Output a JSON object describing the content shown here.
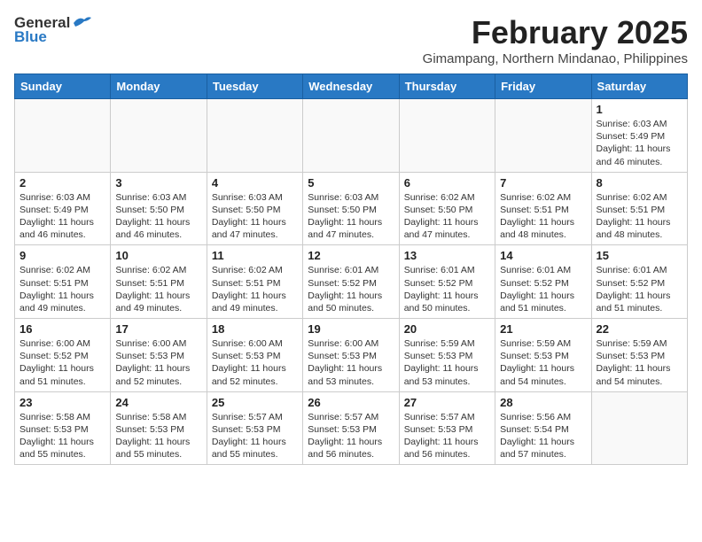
{
  "header": {
    "logo_general": "General",
    "logo_blue": "Blue",
    "title": "February 2025",
    "subtitle": "Gimampang, Northern Mindanao, Philippines"
  },
  "days_of_week": [
    "Sunday",
    "Monday",
    "Tuesday",
    "Wednesday",
    "Thursday",
    "Friday",
    "Saturday"
  ],
  "weeks": [
    [
      {
        "day": "",
        "info": ""
      },
      {
        "day": "",
        "info": ""
      },
      {
        "day": "",
        "info": ""
      },
      {
        "day": "",
        "info": ""
      },
      {
        "day": "",
        "info": ""
      },
      {
        "day": "",
        "info": ""
      },
      {
        "day": "1",
        "info": "Sunrise: 6:03 AM\nSunset: 5:49 PM\nDaylight: 11 hours and 46 minutes."
      }
    ],
    [
      {
        "day": "2",
        "info": "Sunrise: 6:03 AM\nSunset: 5:49 PM\nDaylight: 11 hours and 46 minutes."
      },
      {
        "day": "3",
        "info": "Sunrise: 6:03 AM\nSunset: 5:50 PM\nDaylight: 11 hours and 46 minutes."
      },
      {
        "day": "4",
        "info": "Sunrise: 6:03 AM\nSunset: 5:50 PM\nDaylight: 11 hours and 47 minutes."
      },
      {
        "day": "5",
        "info": "Sunrise: 6:03 AM\nSunset: 5:50 PM\nDaylight: 11 hours and 47 minutes."
      },
      {
        "day": "6",
        "info": "Sunrise: 6:02 AM\nSunset: 5:50 PM\nDaylight: 11 hours and 47 minutes."
      },
      {
        "day": "7",
        "info": "Sunrise: 6:02 AM\nSunset: 5:51 PM\nDaylight: 11 hours and 48 minutes."
      },
      {
        "day": "8",
        "info": "Sunrise: 6:02 AM\nSunset: 5:51 PM\nDaylight: 11 hours and 48 minutes."
      }
    ],
    [
      {
        "day": "9",
        "info": "Sunrise: 6:02 AM\nSunset: 5:51 PM\nDaylight: 11 hours and 49 minutes."
      },
      {
        "day": "10",
        "info": "Sunrise: 6:02 AM\nSunset: 5:51 PM\nDaylight: 11 hours and 49 minutes."
      },
      {
        "day": "11",
        "info": "Sunrise: 6:02 AM\nSunset: 5:51 PM\nDaylight: 11 hours and 49 minutes."
      },
      {
        "day": "12",
        "info": "Sunrise: 6:01 AM\nSunset: 5:52 PM\nDaylight: 11 hours and 50 minutes."
      },
      {
        "day": "13",
        "info": "Sunrise: 6:01 AM\nSunset: 5:52 PM\nDaylight: 11 hours and 50 minutes."
      },
      {
        "day": "14",
        "info": "Sunrise: 6:01 AM\nSunset: 5:52 PM\nDaylight: 11 hours and 51 minutes."
      },
      {
        "day": "15",
        "info": "Sunrise: 6:01 AM\nSunset: 5:52 PM\nDaylight: 11 hours and 51 minutes."
      }
    ],
    [
      {
        "day": "16",
        "info": "Sunrise: 6:00 AM\nSunset: 5:52 PM\nDaylight: 11 hours and 51 minutes."
      },
      {
        "day": "17",
        "info": "Sunrise: 6:00 AM\nSunset: 5:53 PM\nDaylight: 11 hours and 52 minutes."
      },
      {
        "day": "18",
        "info": "Sunrise: 6:00 AM\nSunset: 5:53 PM\nDaylight: 11 hours and 52 minutes."
      },
      {
        "day": "19",
        "info": "Sunrise: 6:00 AM\nSunset: 5:53 PM\nDaylight: 11 hours and 53 minutes."
      },
      {
        "day": "20",
        "info": "Sunrise: 5:59 AM\nSunset: 5:53 PM\nDaylight: 11 hours and 53 minutes."
      },
      {
        "day": "21",
        "info": "Sunrise: 5:59 AM\nSunset: 5:53 PM\nDaylight: 11 hours and 54 minutes."
      },
      {
        "day": "22",
        "info": "Sunrise: 5:59 AM\nSunset: 5:53 PM\nDaylight: 11 hours and 54 minutes."
      }
    ],
    [
      {
        "day": "23",
        "info": "Sunrise: 5:58 AM\nSunset: 5:53 PM\nDaylight: 11 hours and 55 minutes."
      },
      {
        "day": "24",
        "info": "Sunrise: 5:58 AM\nSunset: 5:53 PM\nDaylight: 11 hours and 55 minutes."
      },
      {
        "day": "25",
        "info": "Sunrise: 5:57 AM\nSunset: 5:53 PM\nDaylight: 11 hours and 55 minutes."
      },
      {
        "day": "26",
        "info": "Sunrise: 5:57 AM\nSunset: 5:53 PM\nDaylight: 11 hours and 56 minutes."
      },
      {
        "day": "27",
        "info": "Sunrise: 5:57 AM\nSunset: 5:53 PM\nDaylight: 11 hours and 56 minutes."
      },
      {
        "day": "28",
        "info": "Sunrise: 5:56 AM\nSunset: 5:54 PM\nDaylight: 11 hours and 57 minutes."
      },
      {
        "day": "",
        "info": ""
      }
    ]
  ]
}
